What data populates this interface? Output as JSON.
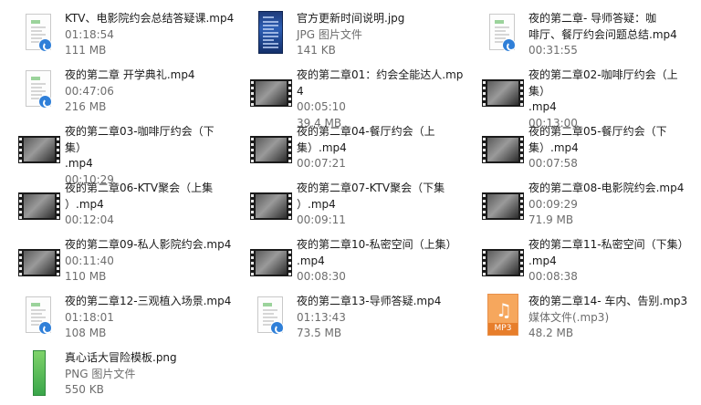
{
  "files": [
    {
      "name": "KTV、电影院约会总结答疑课.mp4",
      "sub1": "01:18:54",
      "sub2": "111 MB",
      "icon": "document-video-icon"
    },
    {
      "name": "官方更新时间说明.jpg",
      "sub1": "JPG 图片文件",
      "sub2": "141 KB",
      "icon": "image-thumbnail-icon"
    },
    {
      "name": "夜的第二章- 导师答疑：咖啡厅、餐厅约会问题总结.mp4",
      "sub1": "00:31:55",
      "sub2": "",
      "icon": "document-video-icon"
    },
    {
      "name": "夜的第二章 开学典礼.mp4",
      "sub1": "00:47:06",
      "sub2": "216 MB",
      "icon": "document-video-icon"
    },
    {
      "name": "夜的第二章01：约会全能达人.mp4",
      "sub1": "00:05:10",
      "sub2": "39.4 MB",
      "icon": "video-thumbnail-icon"
    },
    {
      "name": "夜的第二章02-咖啡厅约会（上集）.mp4",
      "sub1": "00:13:00",
      "sub2": "",
      "icon": "video-thumbnail-icon"
    },
    {
      "name": "夜的第二章03-咖啡厅约会（下集）.mp4",
      "sub1": "00:10:29",
      "sub2": "",
      "icon": "video-thumbnail-icon"
    },
    {
      "name": "夜的第二章04-餐厅约会（上集）.mp4",
      "sub1": "00:07:21",
      "sub2": "",
      "icon": "video-thumbnail-icon"
    },
    {
      "name": "夜的第二章05-餐厅约会（下集）.mp4",
      "sub1": "00:07:58",
      "sub2": "",
      "icon": "video-thumbnail-icon"
    },
    {
      "name": "夜的第二章06-KTV聚会（上集）.mp4",
      "sub1": "00:12:04",
      "sub2": "",
      "icon": "video-thumbnail-icon"
    },
    {
      "name": "夜的第二章07-KTV聚会（下集）.mp4",
      "sub1": "00:09:11",
      "sub2": "",
      "icon": "video-thumbnail-icon"
    },
    {
      "name": "夜的第二章08-电影院约会.mp4",
      "sub1": "00:09:29",
      "sub2": "71.9 MB",
      "icon": "video-thumbnail-icon"
    },
    {
      "name": "夜的第二章09-私人影院约会.mp4",
      "sub1": "00:11:40",
      "sub2": "110 MB",
      "icon": "video-thumbnail-icon"
    },
    {
      "name": "夜的第二章10-私密空间（上集）.mp4",
      "sub1": "00:08:30",
      "sub2": "",
      "icon": "video-thumbnail-icon"
    },
    {
      "name": "夜的第二章11-私密空间（下集）.mp4",
      "sub1": "00:08:38",
      "sub2": "",
      "icon": "video-thumbnail-icon"
    },
    {
      "name": "夜的第二章12-三观植入场景.mp4",
      "sub1": "01:18:01",
      "sub2": "108 MB",
      "icon": "document-video-icon"
    },
    {
      "name": "夜的第二章13-导师答疑.mp4",
      "sub1": "01:13:43",
      "sub2": "73.5 MB",
      "icon": "document-video-icon"
    },
    {
      "name": "夜的第二章14- 车内、告别.mp3",
      "sub1": "媒体文件(.mp3)",
      "sub2": "48.2 MB",
      "icon": "mp3-file-icon",
      "badge": "MP3"
    },
    {
      "name": "真心话大冒险模板.png",
      "sub1": "PNG 图片文件",
      "sub2": "550 KB",
      "icon": "png-file-icon"
    }
  ]
}
